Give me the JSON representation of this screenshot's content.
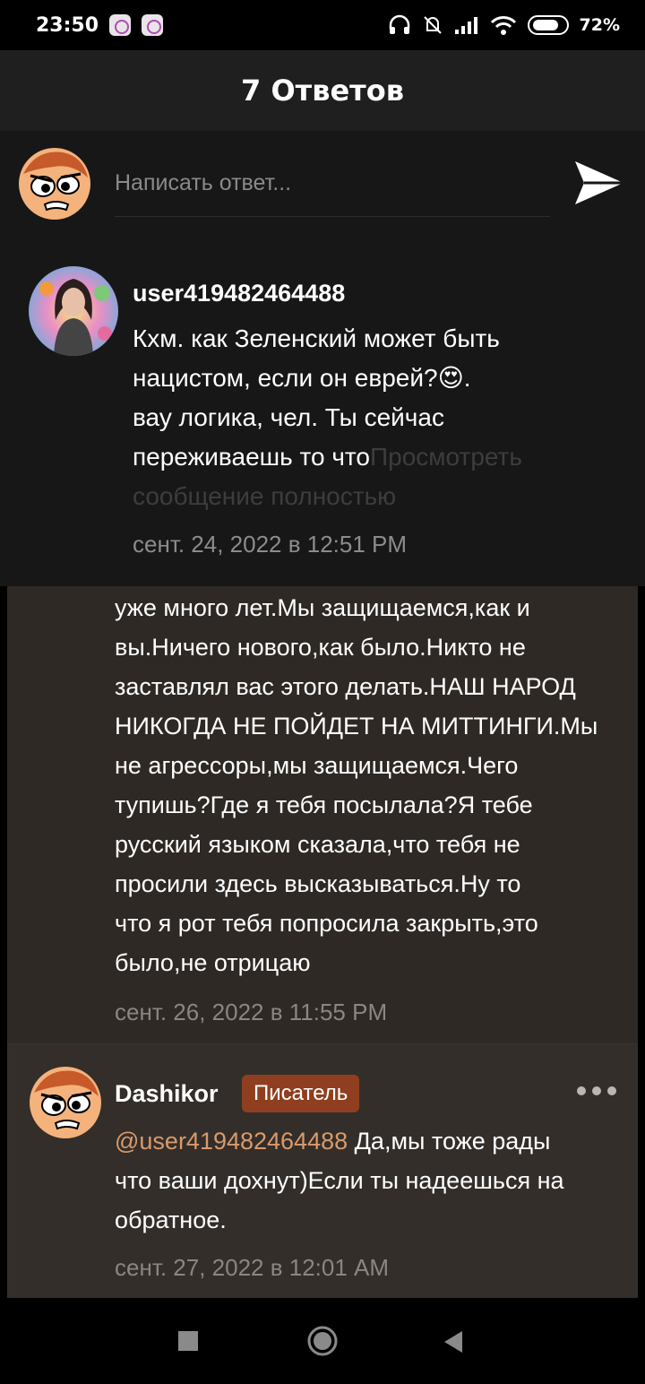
{
  "status_bar": {
    "time": "23:50",
    "icons": [
      "music-app-icon",
      "gallery-app-icon",
      "headphones-icon",
      "mute-icon",
      "signal-icon",
      "wifi-icon",
      "battery-icon"
    ],
    "battery": "72%"
  },
  "header": {
    "title": "7 Ответов"
  },
  "reply": {
    "placeholder": "Написать ответ..."
  },
  "comments": [
    {
      "user": "user419482464488",
      "text_line1": "Кхм. как Зеленский может быть",
      "text_line2": "нацистом, если он еврей?",
      "emoji": "😍",
      "text_line2_end": ".",
      "text_line3": "вау логика, чел. Ты сейчас",
      "text_line4": "переживаешь то что",
      "more_label": "Просмотреть",
      "more_label2": "сообщение полностью",
      "date": "сент. 24, 2022 в 12:51 PM"
    },
    {
      "text_lines": [
        "уже много лет.Мы защищаемся,как и",
        "вы.Ничего нового,как было.Никто не",
        "заставлял вас этого делать.НАШ НАРОД",
        "НИКОГДА НЕ ПОЙДЕТ НА МИТТИНГИ.Мы",
        "не агрессоры,мы защищаемся.Чего",
        "тупишь?Где я тебя посылала?Я тебе",
        "русский языком сказала,что тебя не",
        "просили здесь высказываться.Ну то",
        "что я рот тебя попросила закрыть,это",
        "было,не отрицаю"
      ],
      "date": "сент. 26, 2022 в 11:55 PM"
    },
    {
      "user": "Dashikor",
      "badge": "Писатель",
      "mention": "@user419482464488",
      "text_after_mention": " Да,мы тоже рады",
      "text_line2": "что ваши дохнут)Если ты надеешься на",
      "text_line3": "обратное.",
      "date": "сент. 27, 2022 в 12:01 AM"
    }
  ],
  "colors": {
    "badge": "#8f3f1f",
    "mention": "#d99a6a",
    "highlight_bg": "#2e2925"
  }
}
